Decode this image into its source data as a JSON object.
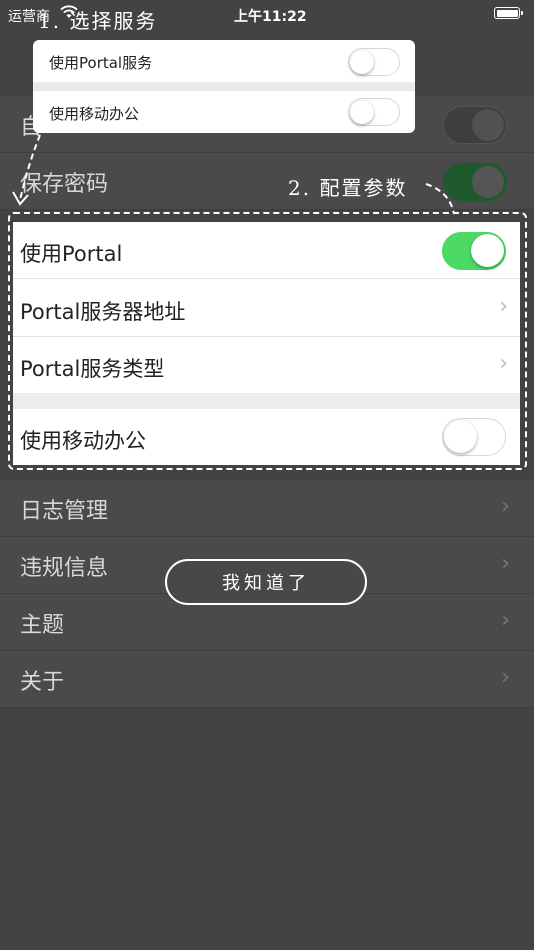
{
  "status_bar": {
    "carrier": "运营商",
    "time": "上午11:22"
  },
  "background_list": {
    "items": [
      {
        "label": "自",
        "control": "toggle",
        "on": false
      },
      {
        "label": "保存密码",
        "control": "toggle",
        "on": true
      },
      {
        "label": "日志管理",
        "control": "chevron"
      },
      {
        "label": "违规信息",
        "control": "chevron"
      },
      {
        "label": "主题",
        "control": "chevron"
      },
      {
        "label": "关于",
        "control": "chevron"
      }
    ]
  },
  "card": {
    "use_portal": {
      "label": "使用Portal",
      "on": true
    },
    "portal_server_address": {
      "label": "Portal服务器地址"
    },
    "portal_service_type": {
      "label": "Portal服务类型"
    },
    "use_mobile_office": {
      "label": "使用移动办公",
      "on": false
    }
  },
  "popup": {
    "use_portal_service": {
      "label": "使用Portal服务",
      "on": false
    },
    "use_mobile_office": {
      "label": "使用移动办公",
      "on": false
    }
  },
  "annotations": {
    "step1": "1. 选择服务",
    "step2": "2. 配置参数"
  },
  "got_it_button": "我知道了",
  "icons": {
    "wifi": "wifi-icon",
    "battery": "battery-icon",
    "chevron": "chevron-right-icon"
  },
  "colors": {
    "toggle_on": "#4cd964",
    "overlay_bg": "#434343"
  }
}
